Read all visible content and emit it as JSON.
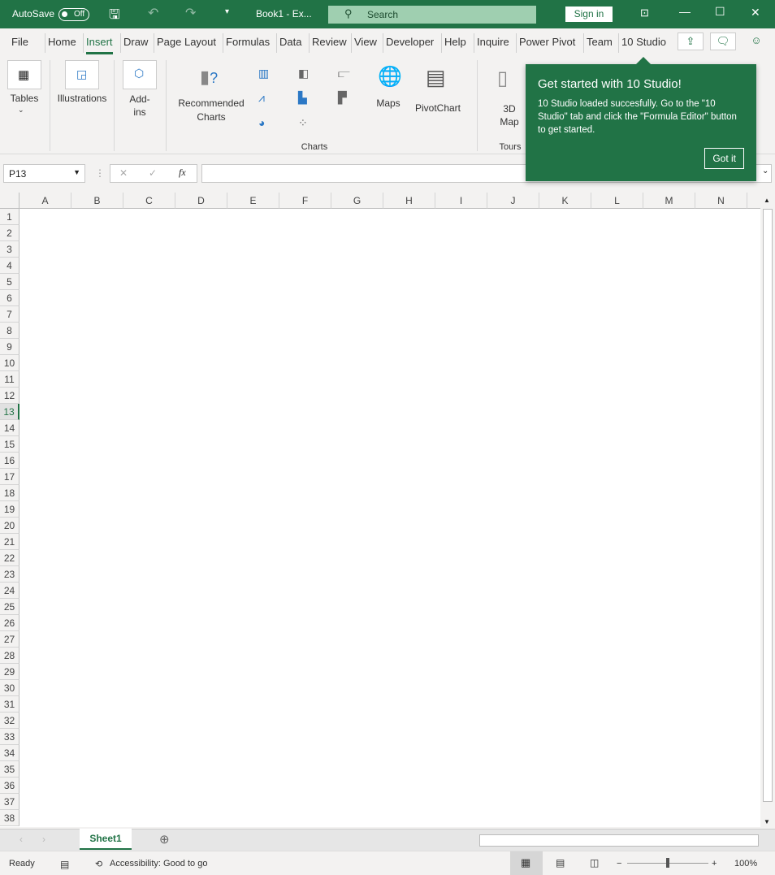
{
  "titlebar": {
    "autosave_label": "AutoSave",
    "autosave_state": "Off",
    "doc_title": "Book1  -  Ex...",
    "search_placeholder": "Search",
    "sign_in": "Sign in"
  },
  "tabs": [
    "File",
    "Home",
    "Insert",
    "Draw",
    "Page Layout",
    "Formulas",
    "Data",
    "Review",
    "View",
    "Developer",
    "Help",
    "Inquire",
    "Power Pivot",
    "Team",
    "10 Studio"
  ],
  "active_tab": "Insert",
  "ribbon": {
    "tables": "Tables",
    "illustrations": "Illustrations",
    "addins": "Add-\nins",
    "recommended_charts_1": "Recommended",
    "recommended_charts_2": "Charts",
    "maps": "Maps",
    "pivotchart": "PivotChart",
    "map3d_1": "3D",
    "map3d_2": "Map",
    "charts_group": "Charts",
    "tours_group": "Tours"
  },
  "formula_bar": {
    "name_box": "P13",
    "cancel": "✕",
    "enter": "✓",
    "fx": "fx",
    "value": ""
  },
  "columns": [
    "A",
    "B",
    "C",
    "D",
    "E",
    "F",
    "G",
    "H",
    "I",
    "J",
    "K",
    "L",
    "M",
    "N"
  ],
  "rows": [
    "1",
    "2",
    "3",
    "4",
    "5",
    "6",
    "7",
    "8",
    "9",
    "10",
    "11",
    "12",
    "13",
    "14",
    "15",
    "16",
    "17",
    "18",
    "19",
    "20",
    "21",
    "22",
    "23",
    "24",
    "25",
    "26",
    "27",
    "28",
    "29",
    "30",
    "31",
    "32",
    "33",
    "34",
    "35",
    "36",
    "37",
    "38"
  ],
  "selected_row": "13",
  "sheets": [
    "Sheet1"
  ],
  "status": {
    "ready": "Ready",
    "accessibility": "Accessibility: Good to go",
    "zoom": "100%",
    "zoom_level_percent": 100
  },
  "tooltip": {
    "title": "Get started with 10 Studio!",
    "body": "10 Studio loaded succesfully. Go to the \"10 Studio\" tab and click the \"Formula Editor\" button to get started.",
    "button": "Got it"
  },
  "colors": {
    "accent": "#217346"
  }
}
